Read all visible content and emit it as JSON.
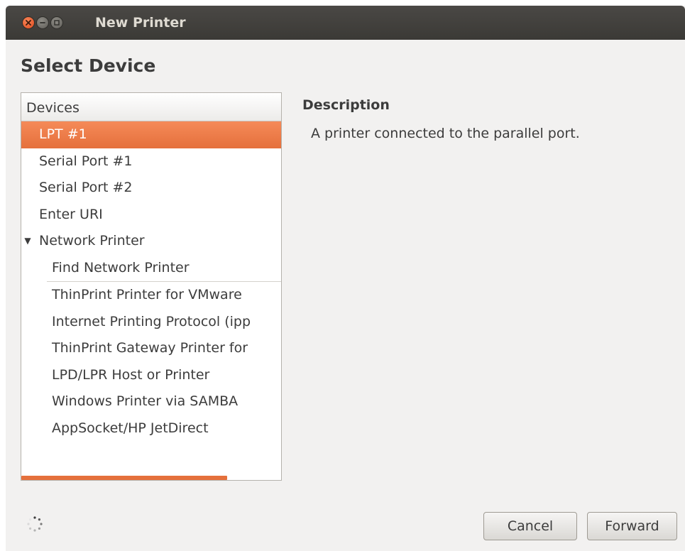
{
  "window": {
    "title": "New Printer",
    "heading": "Select Device"
  },
  "device_list": {
    "column_header": "Devices",
    "items": [
      {
        "label": "LPT #1",
        "level": 1,
        "selected": true
      },
      {
        "label": "Serial Port #1",
        "level": 1
      },
      {
        "label": "Serial Port #2",
        "level": 1
      },
      {
        "label": "Enter URI",
        "level": 1
      },
      {
        "label": "Network Printer",
        "level": 1,
        "expanded": true
      },
      {
        "label": "Find Network Printer",
        "level": 2
      },
      {
        "label": "ThinPrint Printer for VMware",
        "level": 2
      },
      {
        "label": "Internet Printing Protocol (ipp",
        "level": 2
      },
      {
        "label": "ThinPrint Gateway Printer for",
        "level": 2
      },
      {
        "label": "LPD/LPR Host or Printer",
        "level": 2
      },
      {
        "label": "Windows Printer via SAMBA",
        "level": 2
      },
      {
        "label": "AppSocket/HP JetDirect",
        "level": 2
      }
    ]
  },
  "description": {
    "title": "Description",
    "text": "A printer connected to the parallel port."
  },
  "buttons": {
    "cancel": "Cancel",
    "forward": "Forward"
  },
  "icons": {
    "close": "close-icon",
    "minimize": "minimize-icon",
    "maximize": "maximize-icon",
    "expander": "triangle-down-icon",
    "spinner": "spinner-icon"
  },
  "colors": {
    "accent": "#e5703c",
    "titlebar": "#3c3b37",
    "window_bg": "#f2f1f0"
  }
}
